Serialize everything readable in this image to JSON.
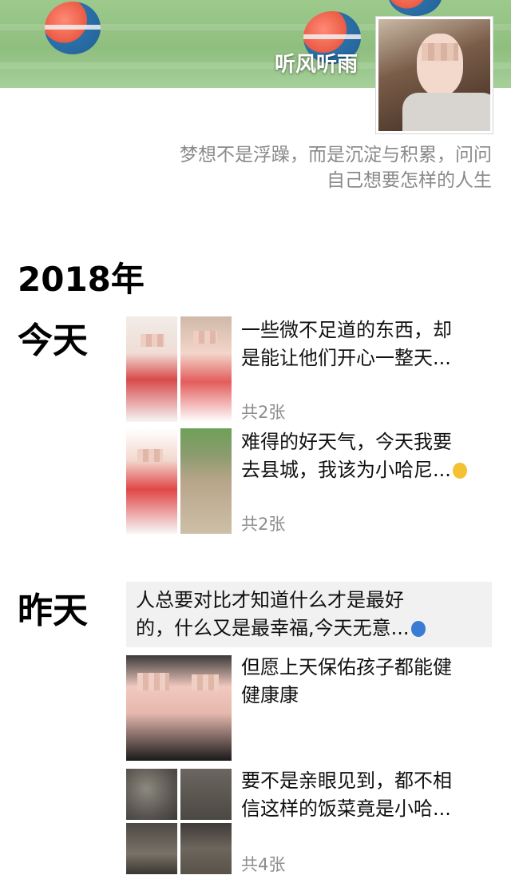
{
  "profile": {
    "nickname": "听风听雨",
    "signature_line1": "梦想不是浮躁，而是沉淀与积累，问问",
    "signature_line2": "自己想要怎样的人生"
  },
  "timeline": {
    "year": "2018年",
    "groups": [
      {
        "day": "今天",
        "posts": [
          {
            "text_line1": "一些微不足道的东西，却",
            "text_line2": "是能让他们开心一整天...",
            "count": "共2张"
          },
          {
            "text_line1": "难得的好天气，今天我要",
            "text_line2": "去县城，我该为小哈尼...",
            "count": "共2张"
          }
        ]
      },
      {
        "day": "昨天",
        "posts": [
          {
            "text_line1": "人总要对比才知道什么才是最好",
            "text_line2": "的，什么又是最幸福,今天无意..."
          },
          {
            "text_line1": "但愿上天保佑孩子都能健",
            "text_line2": "健康康"
          },
          {
            "text_line1": "要不是亲眼见到，都不相",
            "text_line2": "信这样的饭菜竟是小哈...",
            "count": "共4张"
          }
        ]
      }
    ]
  }
}
